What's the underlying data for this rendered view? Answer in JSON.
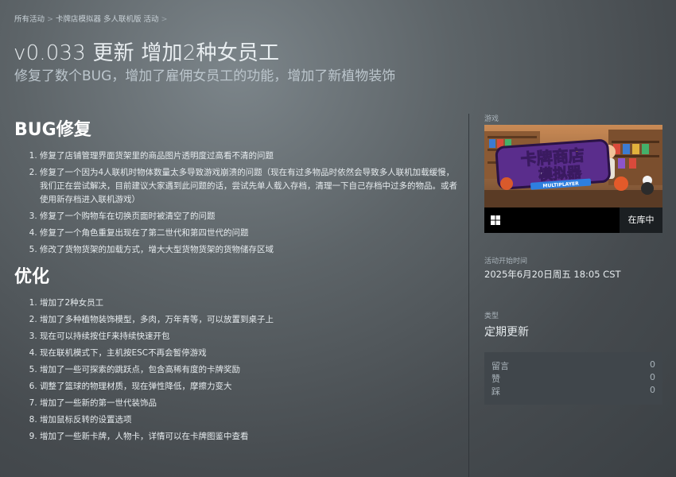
{
  "breadcrumb": {
    "items": [
      "所有活动",
      "卡牌店模拟器 多人联机版 活动"
    ],
    "separator": ">"
  },
  "event": {
    "title": "v0.033 更新 增加2种女员工",
    "subtitle": "修复了数个BUG，增加了雇佣女员工的功能，增加了新植物装饰"
  },
  "sections": [
    {
      "heading": "BUG修复",
      "items": [
        "修复了店铺管理界面货架里的商品图片透明度过高看不清的问题",
        "修复了一个因为4人联机时物体数量太多导致游戏崩溃的问题（现在有过多物品时依然会导致多人联机加载缓慢，我们正在尝试解决，目前建议大家遇到此问题的话，尝试先单人载入存档，清理一下自己存档中过多的物品。或者使用新存档进入联机游戏）",
        "修复了一个购物车在切换页面时被清空了的问题",
        "修复了一个角色重复出现在了第二世代和第四世代的问题",
        "修改了货物货架的加载方式，增大大型货物货架的货物储存区域"
      ]
    },
    {
      "heading": "优化",
      "items": [
        "增加了2种女员工",
        "增加了多种植物装饰模型，多肉，万年青等，可以放置到桌子上",
        "现在可以持续按住F来持续快速开包",
        "现在联机模式下，主机按ESC不再会暂停游戏",
        "增加了一些可探索的跳跃点，包含高稀有度的卡牌奖励",
        "调整了篮球的物理材质，现在弹性降低，摩擦力变大",
        "增加了一些新的第一世代装饰品",
        "增加鼠标反转的设置选项",
        "增加了一些新卡牌，人物卡，详情可以在卡牌图鉴中查看"
      ]
    }
  ],
  "sidebar": {
    "game_label": "游戏",
    "cover_text": "卡牌商店",
    "cover_text2": "模拟器",
    "cover_subtitle": "MULTIPLAYER",
    "platform_icon": "windows-icon",
    "owned_label": "在库中",
    "start_time_label": "活动开始时间",
    "start_time_value": "2025年6月20日周五  18:05 CST",
    "type_label": "类型",
    "type_value": "定期更新",
    "stats": [
      {
        "label": "留言",
        "value": "0"
      },
      {
        "label": "赞",
        "value": "0"
      },
      {
        "label": "踩",
        "value": "0"
      }
    ]
  },
  "colors": {
    "accent_text": "#e6ebee",
    "cover_logo_yellow": "#ffd21a",
    "cover_logo_purple": "#5a2d8c"
  }
}
